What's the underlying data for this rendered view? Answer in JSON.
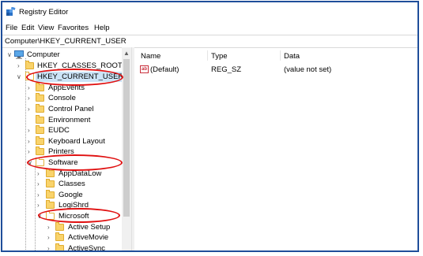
{
  "window": {
    "title": "Registry Editor"
  },
  "menu": [
    "File",
    "Edit",
    "View",
    "Favorites",
    "Help"
  ],
  "address": "Computer\\HKEY_CURRENT_USER",
  "tree": {
    "computer": "Computer",
    "hkcr": "HKEY_CLASSES_ROOT",
    "hkcu": "HKEY_CURRENT_USER",
    "appevents": "AppEvents",
    "console": "Console",
    "control_panel": "Control Panel",
    "environment": "Environment",
    "eudc": "EUDC",
    "keyboard_layout": "Keyboard Layout",
    "printers": "Printers",
    "software": "Software",
    "appdatalow": "AppDataLow",
    "classes": "Classes",
    "google": "Google",
    "logishrd": "LogiShrd",
    "microsoft": "Microsoft",
    "active_setup": "Active Setup",
    "activemovie": "ActiveMovie",
    "activesync": "ActiveSync"
  },
  "columns": {
    "name": "Name",
    "type": "Type",
    "data": "Data"
  },
  "values": [
    {
      "name": "(Default)",
      "type": "REG_SZ",
      "data": "(value not set)",
      "icon": "reg-string-icon"
    }
  ],
  "colors": {
    "highlight": "#cce4f7",
    "annotation": "#e01010",
    "frame": "#1f4e9a"
  }
}
